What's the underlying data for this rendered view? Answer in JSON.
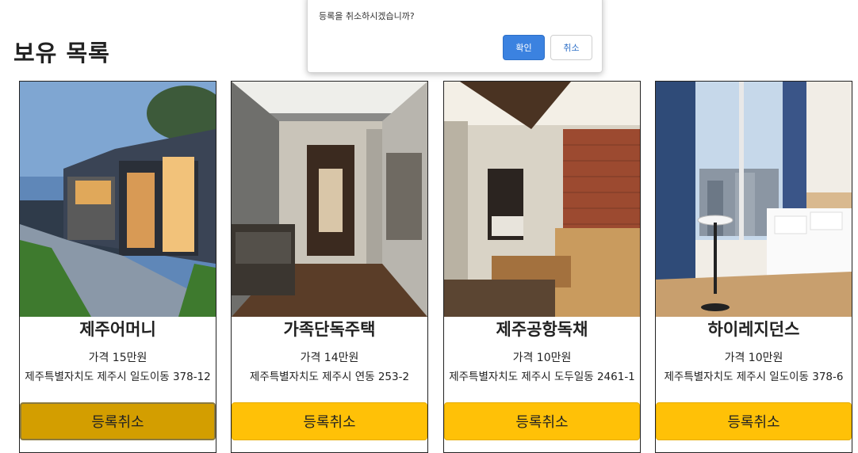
{
  "page": {
    "title": "보유 목록"
  },
  "dialog": {
    "message": "등록을 취소하시겠습니까?",
    "ok_label": "확인",
    "cancel_label": "취소"
  },
  "listings": [
    {
      "name": "제주어머니",
      "price": "가격 15만원",
      "address": "제주특별자치도 제주시 일도이동 378-12",
      "button": "등록취소"
    },
    {
      "name": "가족단독주택",
      "price": "가격 14만원",
      "address": "제주특별자치도 제주시 연동 253-2",
      "button": "등록취소"
    },
    {
      "name": "제주공항독채",
      "price": "가격 10만원",
      "address": "제주특별자치도 제주시 도두일동 2461-1",
      "button": "등록취소"
    },
    {
      "name": "하이레지던스",
      "price": "가격 10만원",
      "address": "제주특별자치도 제주시 일도이동 378-6",
      "button": "등록취소"
    }
  ],
  "colors": {
    "button": "#ffc107",
    "button_hover": "#d39e00",
    "dialog_ok": "#3b82e0"
  }
}
